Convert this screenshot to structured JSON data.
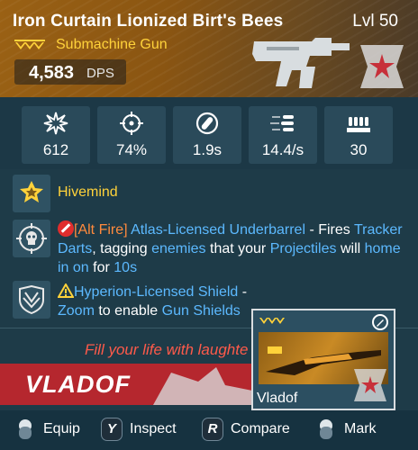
{
  "item": {
    "name": "Iron Curtain Lionized Birt's Bees",
    "level": "Lvl 50",
    "type": "Submachine Gun",
    "dps_value": "4,583",
    "dps_label": "DPS",
    "rarity_color": "#ffd23a",
    "manufacturer_icon": "vladof-star-emblem-icon"
  },
  "stats": [
    {
      "icon": "damage-burst-icon",
      "value": "612"
    },
    {
      "icon": "accuracy-crosshair-icon",
      "value": "74%"
    },
    {
      "icon": "reload-icon",
      "value": "1.9s"
    },
    {
      "icon": "fire-rate-icon",
      "value": "14.4/s"
    },
    {
      "icon": "magazine-ammo-icon",
      "value": "30"
    }
  ],
  "perks": {
    "hivemind": {
      "icon": "star-badge-icon",
      "label": "Hivemind"
    },
    "underbarrel": {
      "icon": "skull-target-icon",
      "alt_fire": "[Alt Fire]",
      "title": "Atlas-Licensed Underbarrel",
      "text_1": " - Fires ",
      "tracker": "Tracker Darts",
      "text_2": ", tagging ",
      "enemies": "enemies",
      "text_3": " that your ",
      "projectiles": "Projectiles",
      "text_4": " will ",
      "home": "home in on",
      "text_5": " for ",
      "duration": "10s"
    },
    "shield": {
      "icon": "shield-crest-icon",
      "title": "Hyperion-Licensed Shield",
      "text_1": " - ",
      "zoom": "Zoom",
      "text_2": " to enable ",
      "gun_shields": "Gun Shields"
    }
  },
  "flavor_text": "Fill your life with laughte",
  "manufacturer_banner": "VLADOF",
  "compare_card": {
    "label": "Vladof"
  },
  "actions": [
    {
      "key": "",
      "label": "Equip"
    },
    {
      "key": "Y",
      "label": "Inspect"
    },
    {
      "key": "R",
      "label": "Compare"
    },
    {
      "key": "",
      "label": "Mark"
    }
  ]
}
